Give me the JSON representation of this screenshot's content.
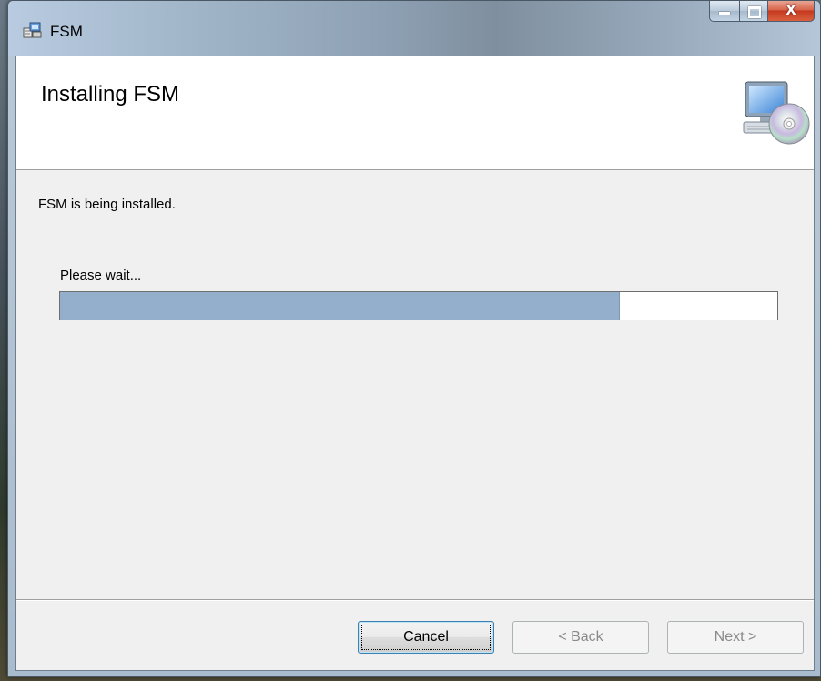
{
  "window": {
    "title": "FSM",
    "controls": {
      "minimize": "minimize",
      "maximize": "maximize",
      "close": "X"
    }
  },
  "banner": {
    "title": "Installing FSM",
    "icon": "computer-cd-icon"
  },
  "body": {
    "status": "FSM is being installed.",
    "wait_label": "Please wait...",
    "progress": 0.78
  },
  "buttons": {
    "cancel": "Cancel",
    "back": "< Back",
    "next": "Next >"
  },
  "colors": {
    "progress_fill": "#93afcc",
    "client_bg": "#f0f0f0",
    "close_button": "#c4391f"
  }
}
